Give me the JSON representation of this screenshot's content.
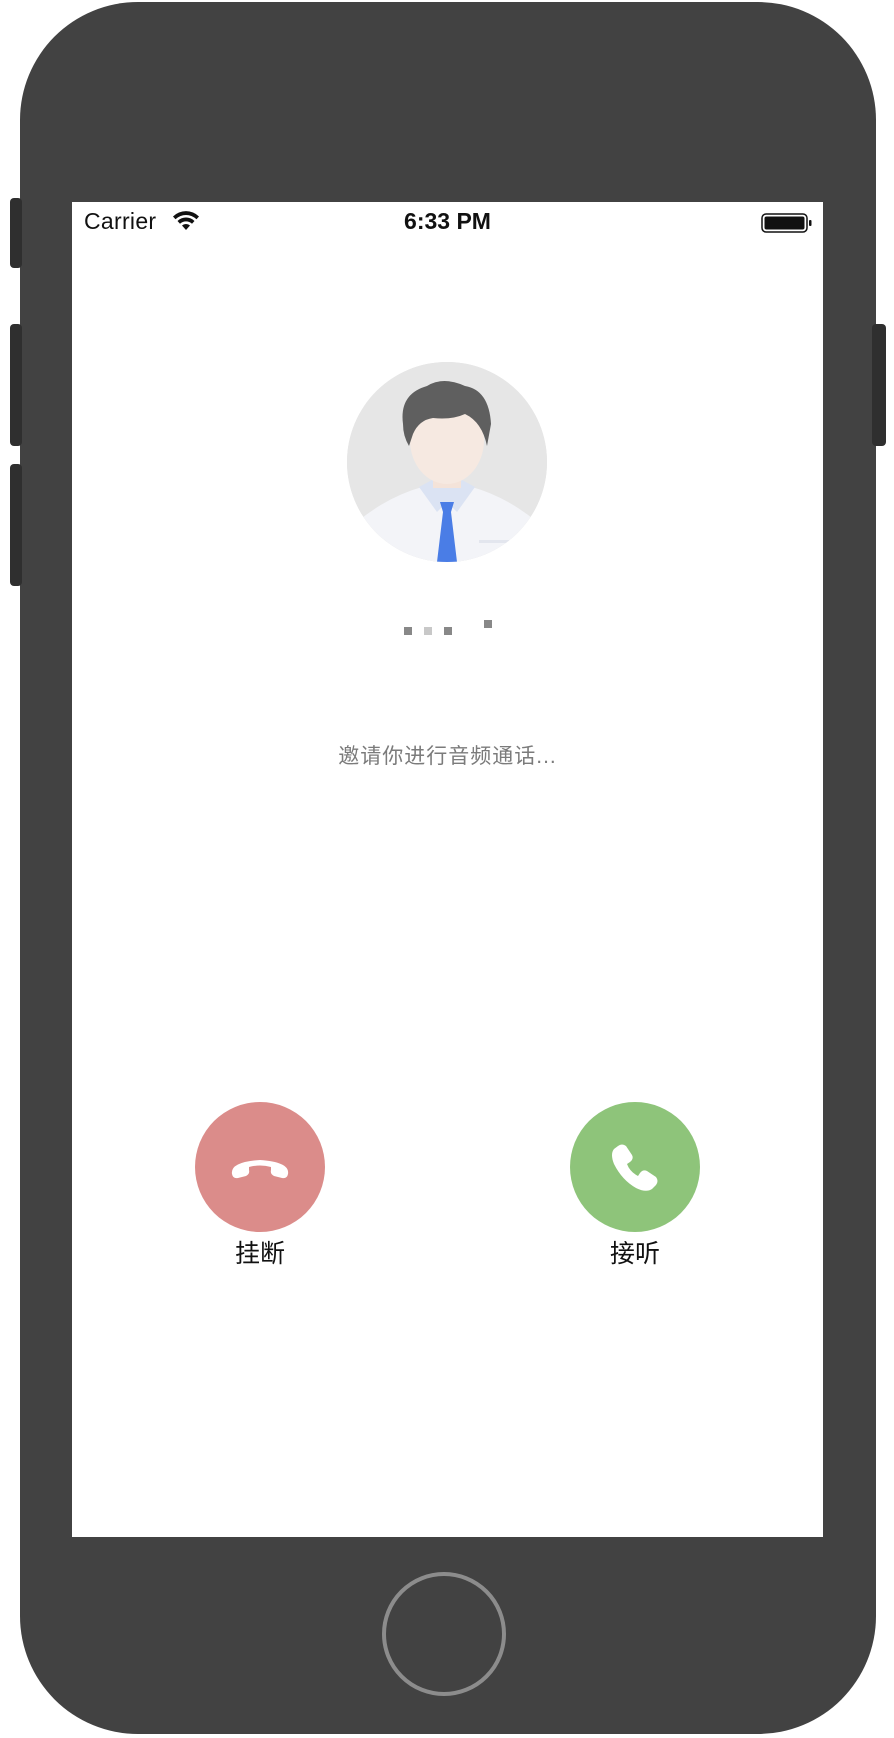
{
  "status_bar": {
    "carrier": "Carrier",
    "time": "6:33 PM",
    "wifi_icon": "wifi-icon",
    "battery_icon": "battery-full-icon"
  },
  "caller": {
    "avatar_icon": "default-male-avatar-icon",
    "name_obscured": true
  },
  "call": {
    "invite_text": "邀请你进行音频通话...",
    "hangup_label": "挂断",
    "answer_label": "接听",
    "hangup_color": "#db8c8a",
    "answer_color": "#8ec47a"
  }
}
